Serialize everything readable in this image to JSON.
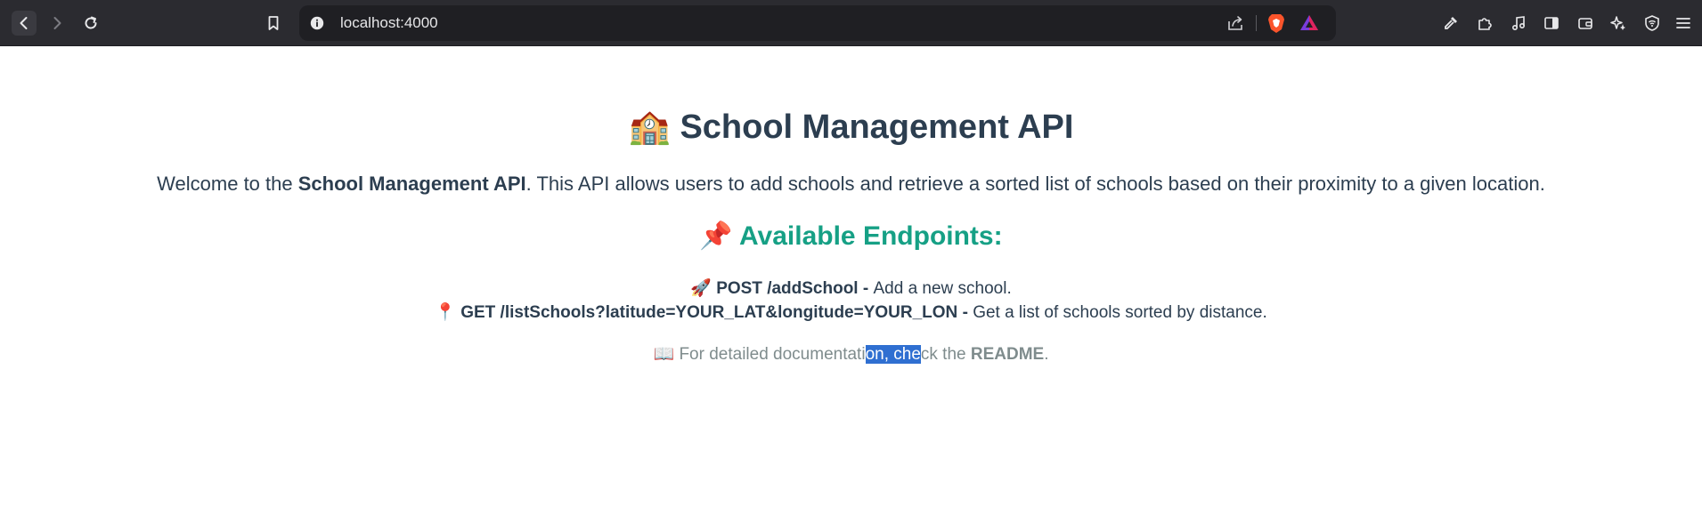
{
  "browser": {
    "url": "localhost:4000"
  },
  "page": {
    "title_icon": "🏫",
    "title": "School Management API",
    "intro": {
      "prefix": "Welcome to the ",
      "bold": "School Management API",
      "suffix": ". This API allows users to add schools and retrieve a sorted list of schools based on their proximity to a given location."
    },
    "endpoints_icon": "📌",
    "endpoints_title": "Available Endpoints:",
    "endpoints": [
      {
        "icon": "🚀",
        "method_path": "POST /addSchool",
        "separator": " - ",
        "description": "Add a new school."
      },
      {
        "icon": "📍",
        "method_path": "GET /listSchools?latitude=YOUR_LAT&longitude=YOUR_LON",
        "separator": " - ",
        "description": "Get a list of schools sorted by distance."
      }
    ],
    "note": {
      "icon": "📖",
      "text_before_selection": "For detailed documentati",
      "selected_text": "on, che",
      "text_after_selection": "ck the ",
      "link": "README",
      "end": "."
    }
  },
  "colors": {
    "toolbar_bg": "#2b2b30",
    "address_bg": "#1f1f23",
    "heading": "#2c3e50",
    "accent": "#16a085",
    "muted": "#7f8c8d",
    "selection": "#2f6fd1"
  },
  "icons": [
    "back-icon",
    "forward-icon",
    "reload-icon",
    "bookmark-icon",
    "info-icon",
    "share-icon",
    "brave-shields-icon",
    "brave-rewards-icon",
    "eyedropper-icon",
    "extensions-icon",
    "media-icon",
    "sidebar-icon",
    "wallet-icon",
    "leo-ai-icon",
    "vpn-icon",
    "menu-icon"
  ]
}
